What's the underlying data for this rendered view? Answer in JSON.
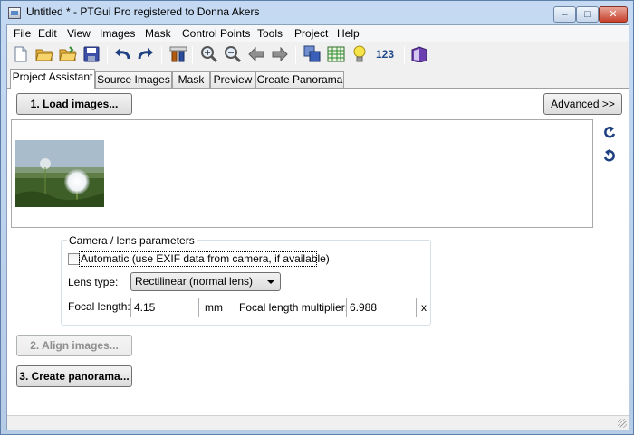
{
  "window": {
    "title": "Untitled * - PTGui Pro registered to Donna Akers",
    "min_glyph": "–",
    "max_glyph": "□",
    "close_glyph": "✕"
  },
  "menu": [
    "File",
    "Edit",
    "View",
    "Images",
    "Mask",
    "Control Points",
    "Tools",
    "Project",
    "Help"
  ],
  "toolbar": {
    "icons": [
      "new-document-icon",
      "open-folder-icon",
      "open-recent-icon",
      "save-icon",
      "undo-icon",
      "redo-icon",
      "tools-icon",
      "zoom-in-icon",
      "zoom-out-icon",
      "back-arrow-icon",
      "forward-arrow-icon",
      "panorama-editor-icon",
      "table-editor-icon",
      "tips-bulb-icon",
      "numeric-transform-icon",
      "help-book-icon"
    ],
    "numeric_label": "123"
  },
  "tabs": [
    "Project Assistant",
    "Source Images",
    "Mask",
    "Preview",
    "Create Panorama"
  ],
  "assistant": {
    "load_button": "1. Load images...",
    "advanced_button": "Advanced >>",
    "align_button": "2. Align images...",
    "create_button": "3. Create panorama..."
  },
  "camera": {
    "group_title": "Camera / lens parameters",
    "automatic_label": "Automatic (use EXIF data from camera, if available)",
    "automatic_checked": false,
    "lens_type_label": "Lens type:",
    "lens_type_value": "Rectilinear (normal lens)",
    "focal_length_label": "Focal length:",
    "focal_length_value": "4.15",
    "focal_unit": "mm",
    "multiplier_label": "Focal length multiplier:",
    "multiplier_value": "6.988",
    "multiplier_unit": "x"
  },
  "colors": {
    "accent": "#234a8a",
    "titlebar": "#c5daf2"
  }
}
